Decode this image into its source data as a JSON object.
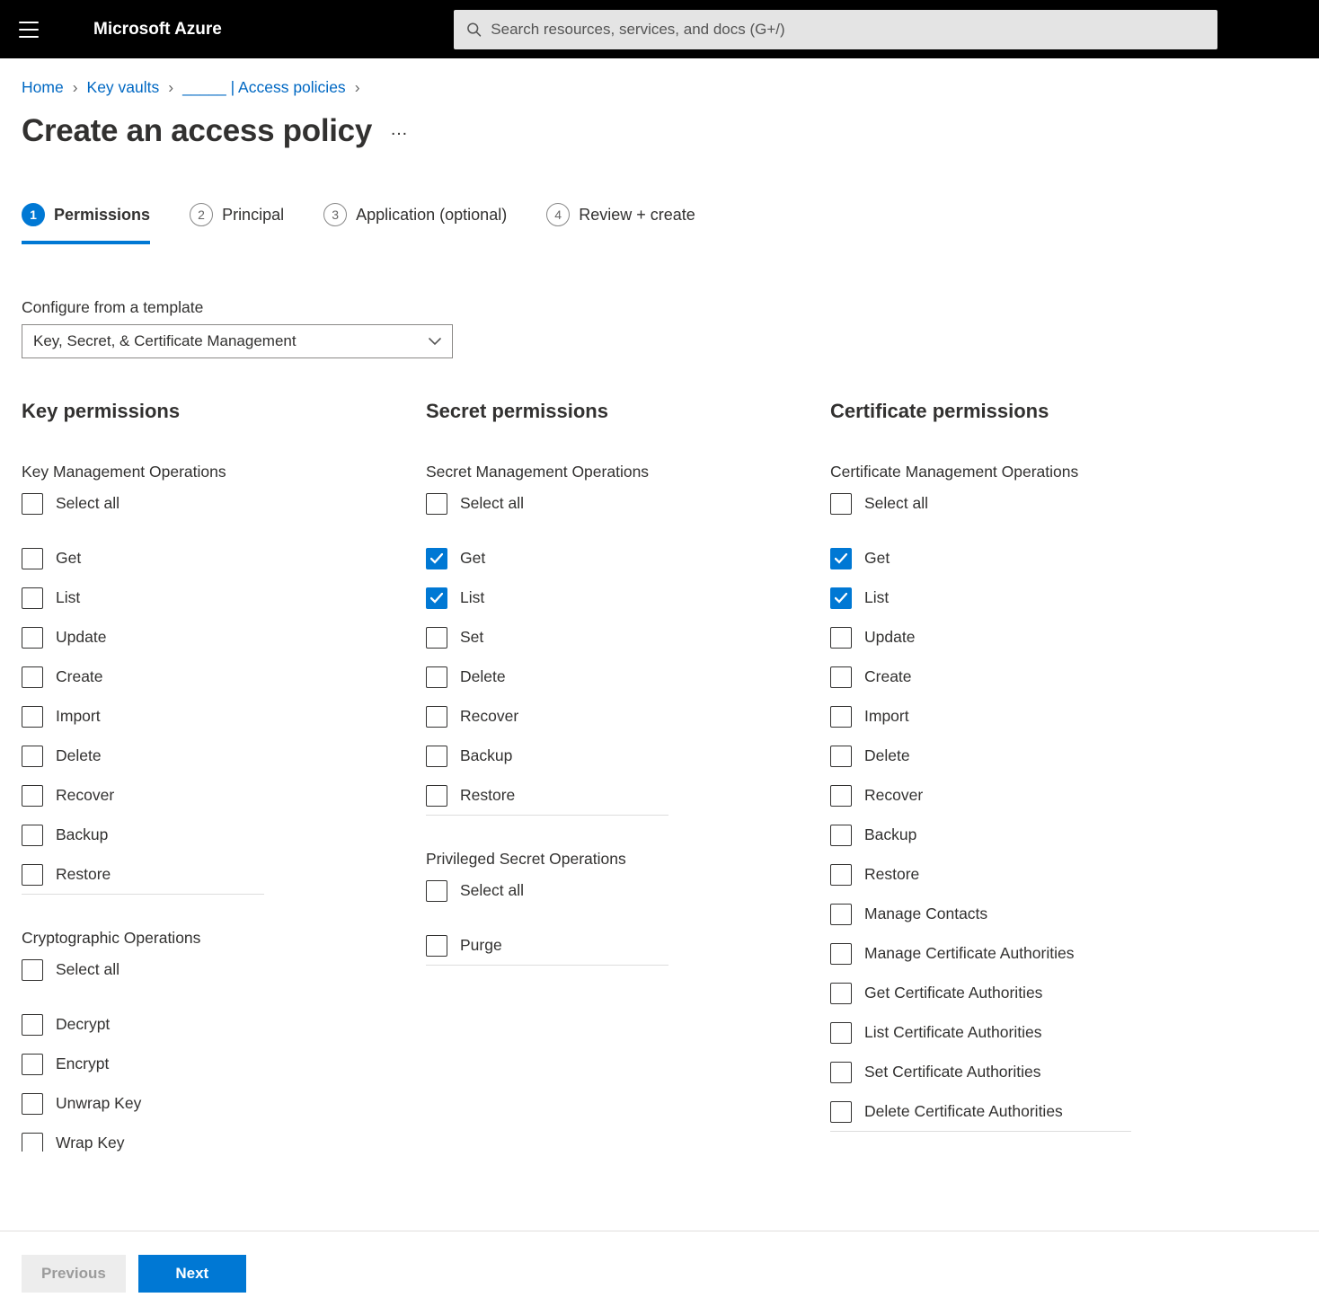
{
  "topbar": {
    "brand": "Microsoft Azure",
    "search_placeholder": "Search resources, services, and docs (G+/)"
  },
  "breadcrumbs": {
    "home": "Home",
    "kv": "Key vaults",
    "res": "_____ | Access policies"
  },
  "page": {
    "title": "Create an access policy",
    "more": "…"
  },
  "wizard": {
    "s1": "Permissions",
    "s2": "Principal",
    "s3": "Application (optional)",
    "s4": "Review + create"
  },
  "template": {
    "label": "Configure from a template",
    "value": "Key, Secret, & Certificate Management"
  },
  "key": {
    "heading": "Key permissions",
    "g1_title": "Key Management Operations",
    "g1_selectall": "Select all",
    "g1": {
      "get": "Get",
      "list": "List",
      "update": "Update",
      "create": "Create",
      "import": "Import",
      "delete": "Delete",
      "recover": "Recover",
      "backup": "Backup",
      "restore": "Restore"
    },
    "g2_title": "Cryptographic Operations",
    "g2_selectall": "Select all",
    "g2": {
      "decrypt": "Decrypt",
      "encrypt": "Encrypt",
      "unwrap": "Unwrap Key",
      "wrap": "Wrap Key"
    }
  },
  "secret": {
    "heading": "Secret permissions",
    "g1_title": "Secret Management Operations",
    "g1_selectall": "Select all",
    "g1": {
      "get": "Get",
      "list": "List",
      "set": "Set",
      "delete": "Delete",
      "recover": "Recover",
      "backup": "Backup",
      "restore": "Restore"
    },
    "g2_title": "Privileged Secret Operations",
    "g2_selectall": "Select all",
    "g2": {
      "purge": "Purge"
    }
  },
  "cert": {
    "heading": "Certificate permissions",
    "g1_title": "Certificate Management Operations",
    "g1_selectall": "Select all",
    "g1": {
      "get": "Get",
      "list": "List",
      "update": "Update",
      "create": "Create",
      "import": "Import",
      "delete": "Delete",
      "recover": "Recover",
      "backup": "Backup",
      "restore": "Restore",
      "mcontacts": "Manage Contacts",
      "mca": "Manage Certificate Authorities",
      "gca": "Get Certificate Authorities",
      "lca": "List Certificate Authorities",
      "sca": "Set Certificate Authorities",
      "dca": "Delete Certificate Authorities"
    }
  },
  "checked": {
    "secret_get": true,
    "secret_list": true,
    "cert_get": true,
    "cert_list": true
  },
  "footer": {
    "prev": "Previous",
    "next": "Next"
  }
}
